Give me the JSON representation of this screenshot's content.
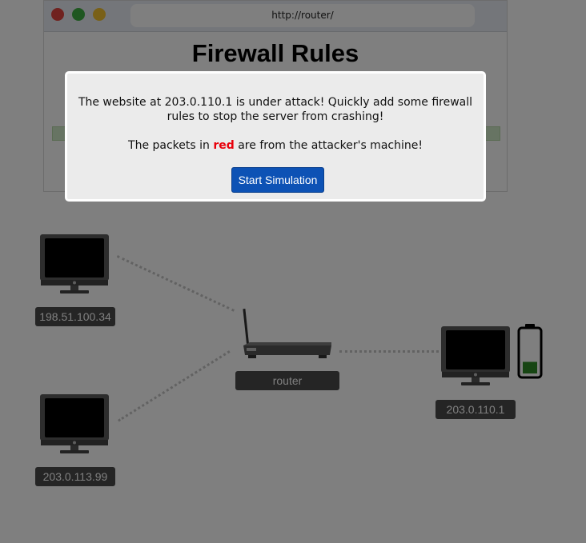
{
  "browser": {
    "url": "http://router/",
    "page_title": "Firewall Rules"
  },
  "network": {
    "hosts": [
      {
        "ip": "198.51.100.34"
      },
      {
        "ip": "203.0.113.99"
      },
      {
        "ip": "203.0.110.1"
      }
    ],
    "router_label": "router",
    "server_battery_level": 0.25
  },
  "modal": {
    "message": "The website at 203.0.110.1 is under attack! Quickly add some firewall rules to stop the server from crashing!",
    "warning_prefix": "The packets in ",
    "warning_highlight": "red",
    "warning_suffix": " are from the attacker's machine!",
    "start_button": "Start Simulation"
  },
  "colors": {
    "button": "#0d52b5",
    "highlight_red": "#e8000b",
    "battery_fill": "#2e8b26"
  }
}
